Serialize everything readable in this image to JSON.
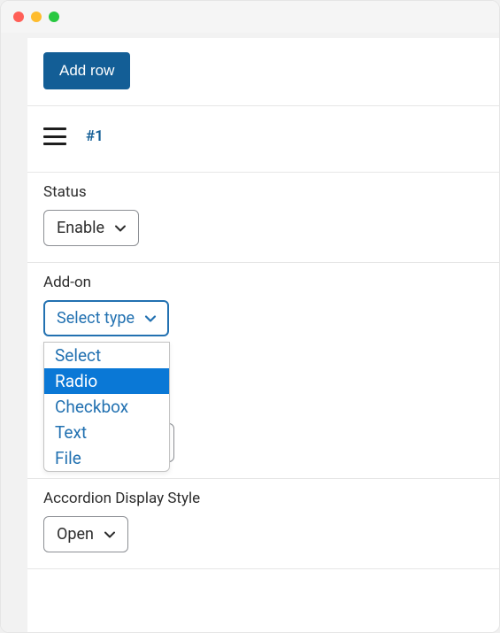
{
  "toolbar": {
    "add_row_label": "Add row"
  },
  "row": {
    "title": "#1"
  },
  "fields": {
    "status": {
      "label": "Status",
      "value": "Enable"
    },
    "addon": {
      "label": "Add-on",
      "value": "Select type",
      "options": [
        "Select",
        "Radio",
        "Checkbox",
        "Text",
        "File"
      ],
      "highlighted_index": 1
    },
    "accordion": {
      "label": "Accordion Display Style",
      "value": "Open"
    }
  }
}
